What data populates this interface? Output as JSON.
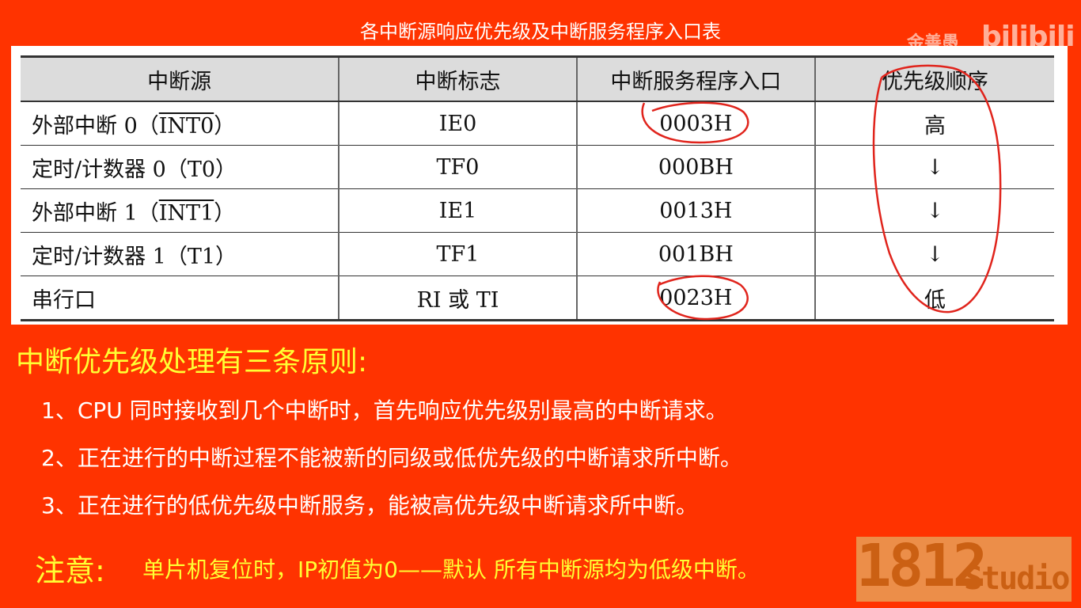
{
  "caption": "各中断源响应优先级及中断服务程序入口表",
  "watermark": {
    "author": "金善愚",
    "logo": "bilibili"
  },
  "table": {
    "headers": [
      "中断源",
      "中断标志",
      "中断服务程序入口",
      "优先级顺序"
    ],
    "rows": [
      {
        "src_prefix": "外部中断 0（",
        "src_overline": "INT0",
        "src_suffix": "）",
        "flag": "IE0",
        "entry": "0003H",
        "priority": "高"
      },
      {
        "src_prefix": "定时/计数器 0（T0）",
        "src_overline": "",
        "src_suffix": "",
        "flag": "TF0",
        "entry": "000BH",
        "priority": "↓"
      },
      {
        "src_prefix": "外部中断 1（",
        "src_overline": "INT1",
        "src_suffix": "）",
        "flag": "IE1",
        "entry": "0013H",
        "priority": "↓"
      },
      {
        "src_prefix": "定时/计数器 1（T1）",
        "src_overline": "",
        "src_suffix": "",
        "flag": "TF1",
        "entry": "001BH",
        "priority": "↓"
      },
      {
        "src_prefix": "串行口",
        "src_overline": "",
        "src_suffix": "",
        "flag": "RI 或 TI",
        "entry": "0023H",
        "priority": "低"
      }
    ]
  },
  "heading": "中断优先级处理有三条原则:",
  "rules": [
    "1、CPU 同时接收到几个中断时，首先响应优先级别最高的中断请求。",
    "2、正在进行的中断过程不能被新的同级或低优先级的中断请求所中断。",
    "3、正在进行的低优先级中断服务，能被高优先级中断请求所中断。"
  ],
  "note": {
    "label": "注意:",
    "text": "单片机复位时，IP初值为0——默认 所有中断源均为低级中断。"
  },
  "studio_logo": {
    "number": "1812",
    "word": "Studio"
  },
  "colors": {
    "background": "#ff3300",
    "highlight_text": "#ffff33",
    "body_text": "#ffffff",
    "pen_annotation": "#e0241c"
  }
}
